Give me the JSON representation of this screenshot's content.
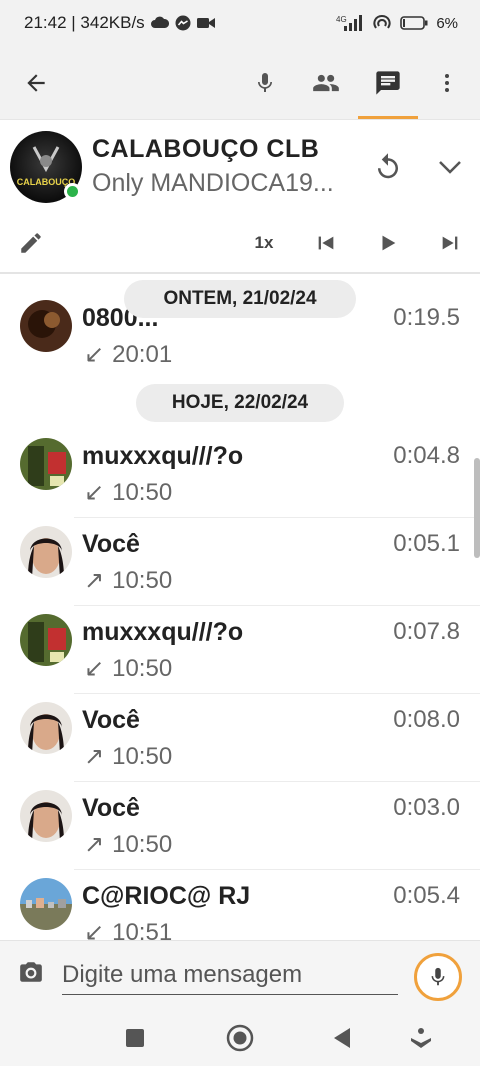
{
  "status_bar": {
    "time_speed": "21:42 | 342KB/s",
    "network": "4G",
    "battery": "6%"
  },
  "toolbar": {
    "active_tab": "chat",
    "accent_color": "#f0a13c"
  },
  "group": {
    "name": "CALABOUÇO CLB",
    "subtitle": "Only MANDIOCA19...",
    "avatar_text": "CALABOUÇO"
  },
  "playback": {
    "speed": "1x"
  },
  "date_chips": {
    "yesterday": "ONTEM, 21/02/24",
    "today": "HOJE, 22/02/24"
  },
  "messages": [
    {
      "sender": "0800...",
      "duration": "0:19.5",
      "direction": "↙",
      "time": "20:01"
    },
    {
      "sender": "muxxxqu///?o",
      "duration": "0:04.8",
      "direction": "↙",
      "time": "10:50"
    },
    {
      "sender": "Você",
      "duration": "0:05.1",
      "direction": "↗",
      "time": "10:50"
    },
    {
      "sender": "muxxxqu///?o",
      "duration": "0:07.8",
      "direction": "↙",
      "time": "10:50"
    },
    {
      "sender": "Você",
      "duration": "0:08.0",
      "direction": "↗",
      "time": "10:50"
    },
    {
      "sender": "Você",
      "duration": "0:03.0",
      "direction": "↗",
      "time": "10:50"
    },
    {
      "sender": "C@RIOC@ RJ",
      "duration": "0:05.4",
      "direction": "↙",
      "time": "10:51"
    }
  ],
  "input": {
    "placeholder": "Digite uma mensagem"
  }
}
